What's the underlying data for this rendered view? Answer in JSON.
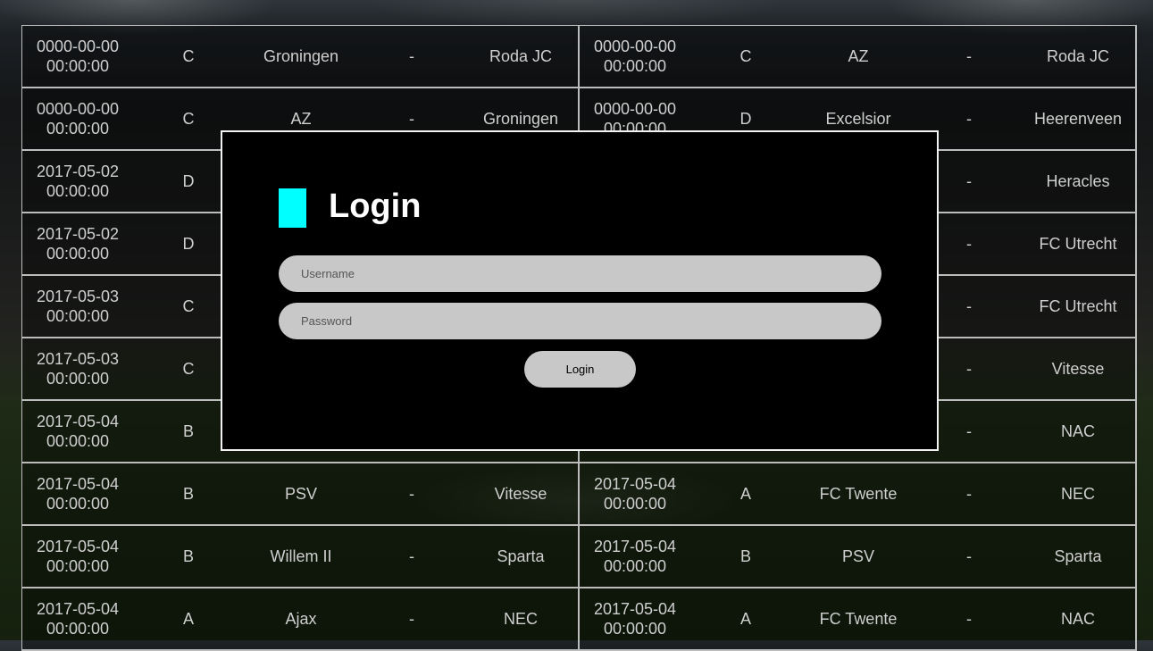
{
  "matches": [
    {
      "date": "0000-00-00",
      "time": "00:00:00",
      "group": "C",
      "home": "Groningen",
      "sep": "-",
      "away": "Roda JC"
    },
    {
      "date": "0000-00-00",
      "time": "00:00:00",
      "group": "C",
      "home": "AZ",
      "sep": "-",
      "away": "Roda JC"
    },
    {
      "date": "0000-00-00",
      "time": "00:00:00",
      "group": "C",
      "home": "AZ",
      "sep": "-",
      "away": "Groningen"
    },
    {
      "date": "0000-00-00",
      "time": "00:00:00",
      "group": "D",
      "home": "Excelsior",
      "sep": "-",
      "away": "Heerenveen"
    },
    {
      "date": "2017-05-02",
      "time": "00:00:00",
      "group": "D",
      "home": "",
      "sep": "",
      "away": ""
    },
    {
      "date": "",
      "time": "",
      "group": "",
      "home": "",
      "sep": "-",
      "away": "Heracles"
    },
    {
      "date": "2017-05-02",
      "time": "00:00:00",
      "group": "D",
      "home": "",
      "sep": "",
      "away": ""
    },
    {
      "date": "",
      "time": "",
      "group": "",
      "home": "",
      "sep": "-",
      "away": "FC Utrecht"
    },
    {
      "date": "2017-05-03",
      "time": "00:00:00",
      "group": "C",
      "home": "",
      "sep": "",
      "away": ""
    },
    {
      "date": "",
      "time": "",
      "group": "",
      "home": "",
      "sep": "-",
      "away": "FC Utrecht"
    },
    {
      "date": "2017-05-03",
      "time": "00:00:00",
      "group": "C",
      "home": "",
      "sep": "",
      "away": ""
    },
    {
      "date": "",
      "time": "",
      "group": "",
      "home": "",
      "sep": "-",
      "away": "Vitesse"
    },
    {
      "date": "2017-05-04",
      "time": "00:00:00",
      "group": "B",
      "home": "",
      "sep": "",
      "away": ""
    },
    {
      "date": "",
      "time": "00:00:00",
      "group": "",
      "home": "",
      "sep": "-",
      "away": "NAC"
    },
    {
      "date": "2017-05-04",
      "time": "00:00:00",
      "group": "B",
      "home": "PSV",
      "sep": "-",
      "away": "Vitesse"
    },
    {
      "date": "2017-05-04",
      "time": "00:00:00",
      "group": "A",
      "home": "FC Twente",
      "sep": "-",
      "away": "NEC"
    },
    {
      "date": "2017-05-04",
      "time": "00:00:00",
      "group": "B",
      "home": "Willem II",
      "sep": "-",
      "away": "Sparta"
    },
    {
      "date": "2017-05-04",
      "time": "00:00:00",
      "group": "B",
      "home": "PSV",
      "sep": "-",
      "away": "Sparta"
    },
    {
      "date": "2017-05-04",
      "time": "00:00:00",
      "group": "A",
      "home": "Ajax",
      "sep": "-",
      "away": "NEC"
    },
    {
      "date": "2017-05-04",
      "time": "00:00:00",
      "group": "A",
      "home": "FC Twente",
      "sep": "-",
      "away": "NAC"
    }
  ],
  "login": {
    "title": "Login",
    "username_placeholder": "Username",
    "password_placeholder": "Password",
    "button_label": "Login",
    "accent_color": "#00ffff"
  }
}
